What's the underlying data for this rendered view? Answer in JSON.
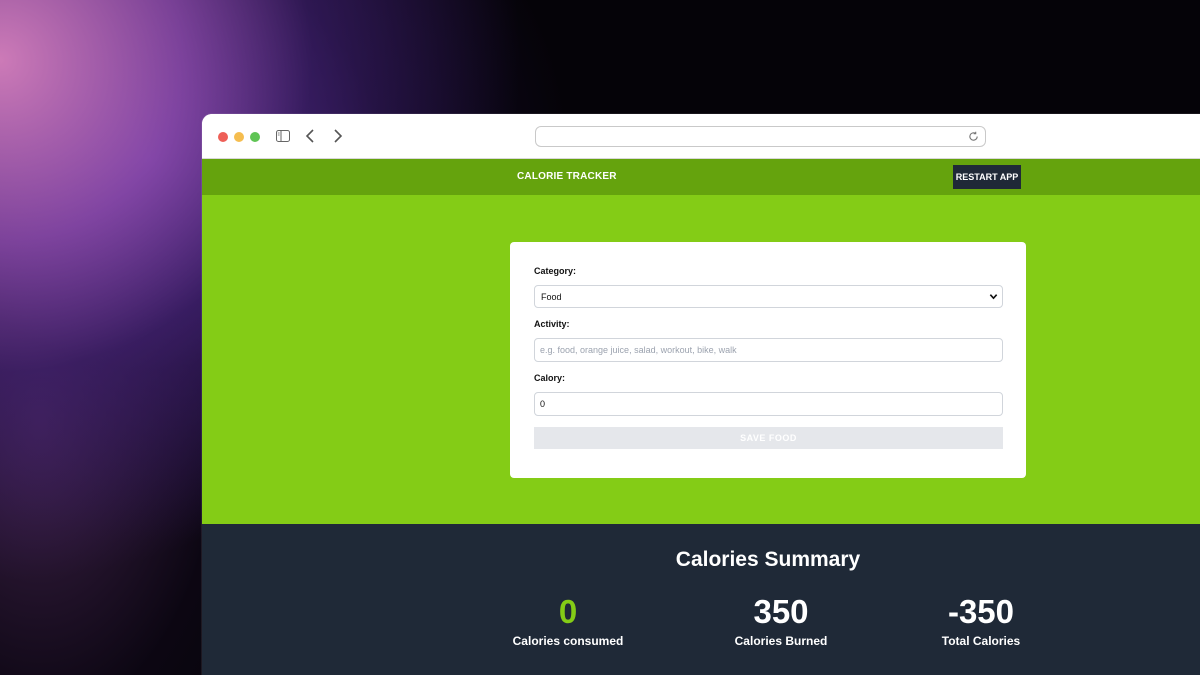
{
  "browser": {
    "url": ""
  },
  "header": {
    "title": "CALORIE TRACKER",
    "restart_label": "RESTART APP"
  },
  "form": {
    "category_label": "Category:",
    "category_value": "Food",
    "activity_label": "Activity:",
    "activity_placeholder": "e.g. food, orange juice, salad, workout, bike, walk",
    "calory_label": "Calory:",
    "calory_value": "0",
    "save_label": "SAVE  FOOD"
  },
  "summary": {
    "title": "Calories Summary",
    "stats": [
      {
        "value": "0",
        "label": "Calories consumed"
      },
      {
        "value": "350",
        "label": "Calories Burned"
      },
      {
        "value": "-350",
        "label": "Total Calories"
      }
    ]
  },
  "colors": {
    "header_green": "#65a30d",
    "hero_green": "#84cc16",
    "summary_dark": "#1f2937",
    "consumed_accent": "#84cc16"
  },
  "icons": [
    "sidebar-toggle-icon",
    "back-arrow-icon",
    "forward-arrow-icon",
    "reload-icon",
    "chevron-down-icon"
  ]
}
